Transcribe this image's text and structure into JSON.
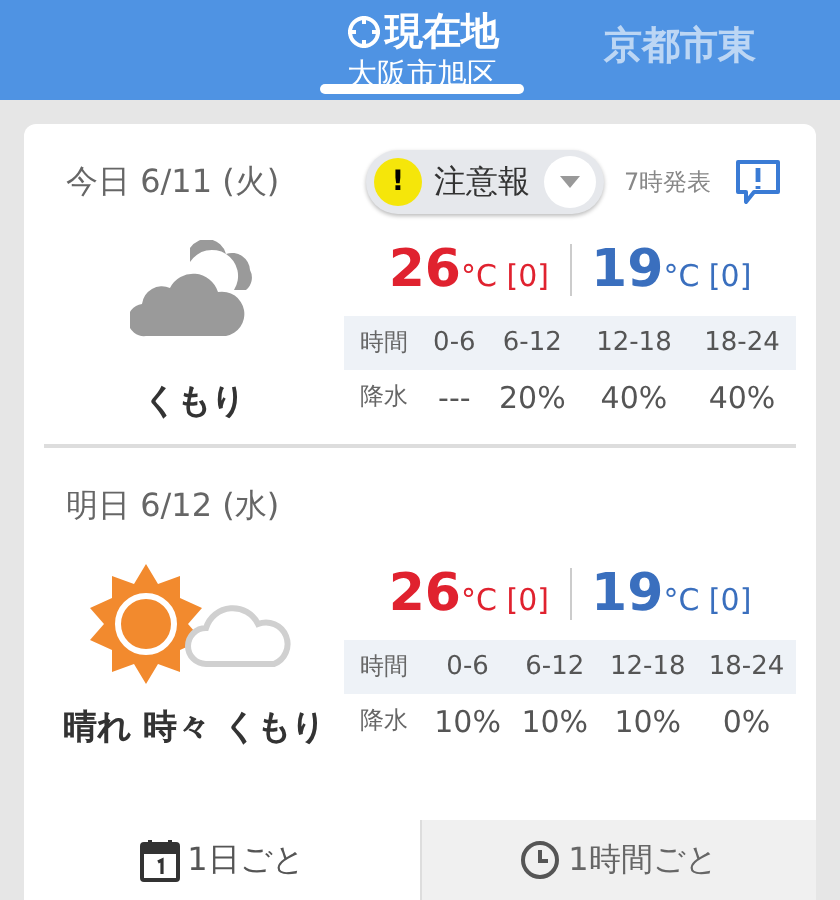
{
  "locations": [
    {
      "kind": "current",
      "name": "現在地",
      "area": "大阪市旭区",
      "selected": true
    },
    {
      "kind": "city",
      "name": "京都市東",
      "selected": false
    }
  ],
  "days": [
    {
      "day": "今日",
      "date": "6/11 (火)",
      "kind": "cloudy",
      "warning": {
        "mark": "!",
        "label": "注意報"
      },
      "issued": "7時発表",
      "weather": "くもり",
      "high": {
        "value": "26",
        "unit": "°C",
        "diff": "[0]"
      },
      "low": {
        "value": "19",
        "unit": "°C",
        "diff": "[0]"
      },
      "table": {
        "columns": [
          "時間",
          "0-6",
          "6-12",
          "12-18",
          "18-24"
        ],
        "rows": [
          [
            "降水",
            "---",
            "20%",
            "40%",
            "40%"
          ]
        ]
      }
    },
    {
      "day": "明日",
      "date": "6/12 (水)",
      "kind": "sunny_cloudy",
      "weather": "晴れ 時々 くもり",
      "high": {
        "value": "26",
        "unit": "°C",
        "diff": "[0]"
      },
      "low": {
        "value": "19",
        "unit": "°C",
        "diff": "[0]"
      },
      "table": {
        "columns": [
          "時間",
          "0-6",
          "6-12",
          "12-18",
          "18-24"
        ],
        "rows": [
          [
            "降水",
            "10%",
            "10%",
            "10%",
            "0%"
          ]
        ]
      }
    }
  ],
  "view_tabs": [
    {
      "kind": "daily",
      "label": "1日ごと",
      "selected": true
    },
    {
      "kind": "hourly",
      "label": "1時間ごと",
      "selected": false
    }
  ]
}
